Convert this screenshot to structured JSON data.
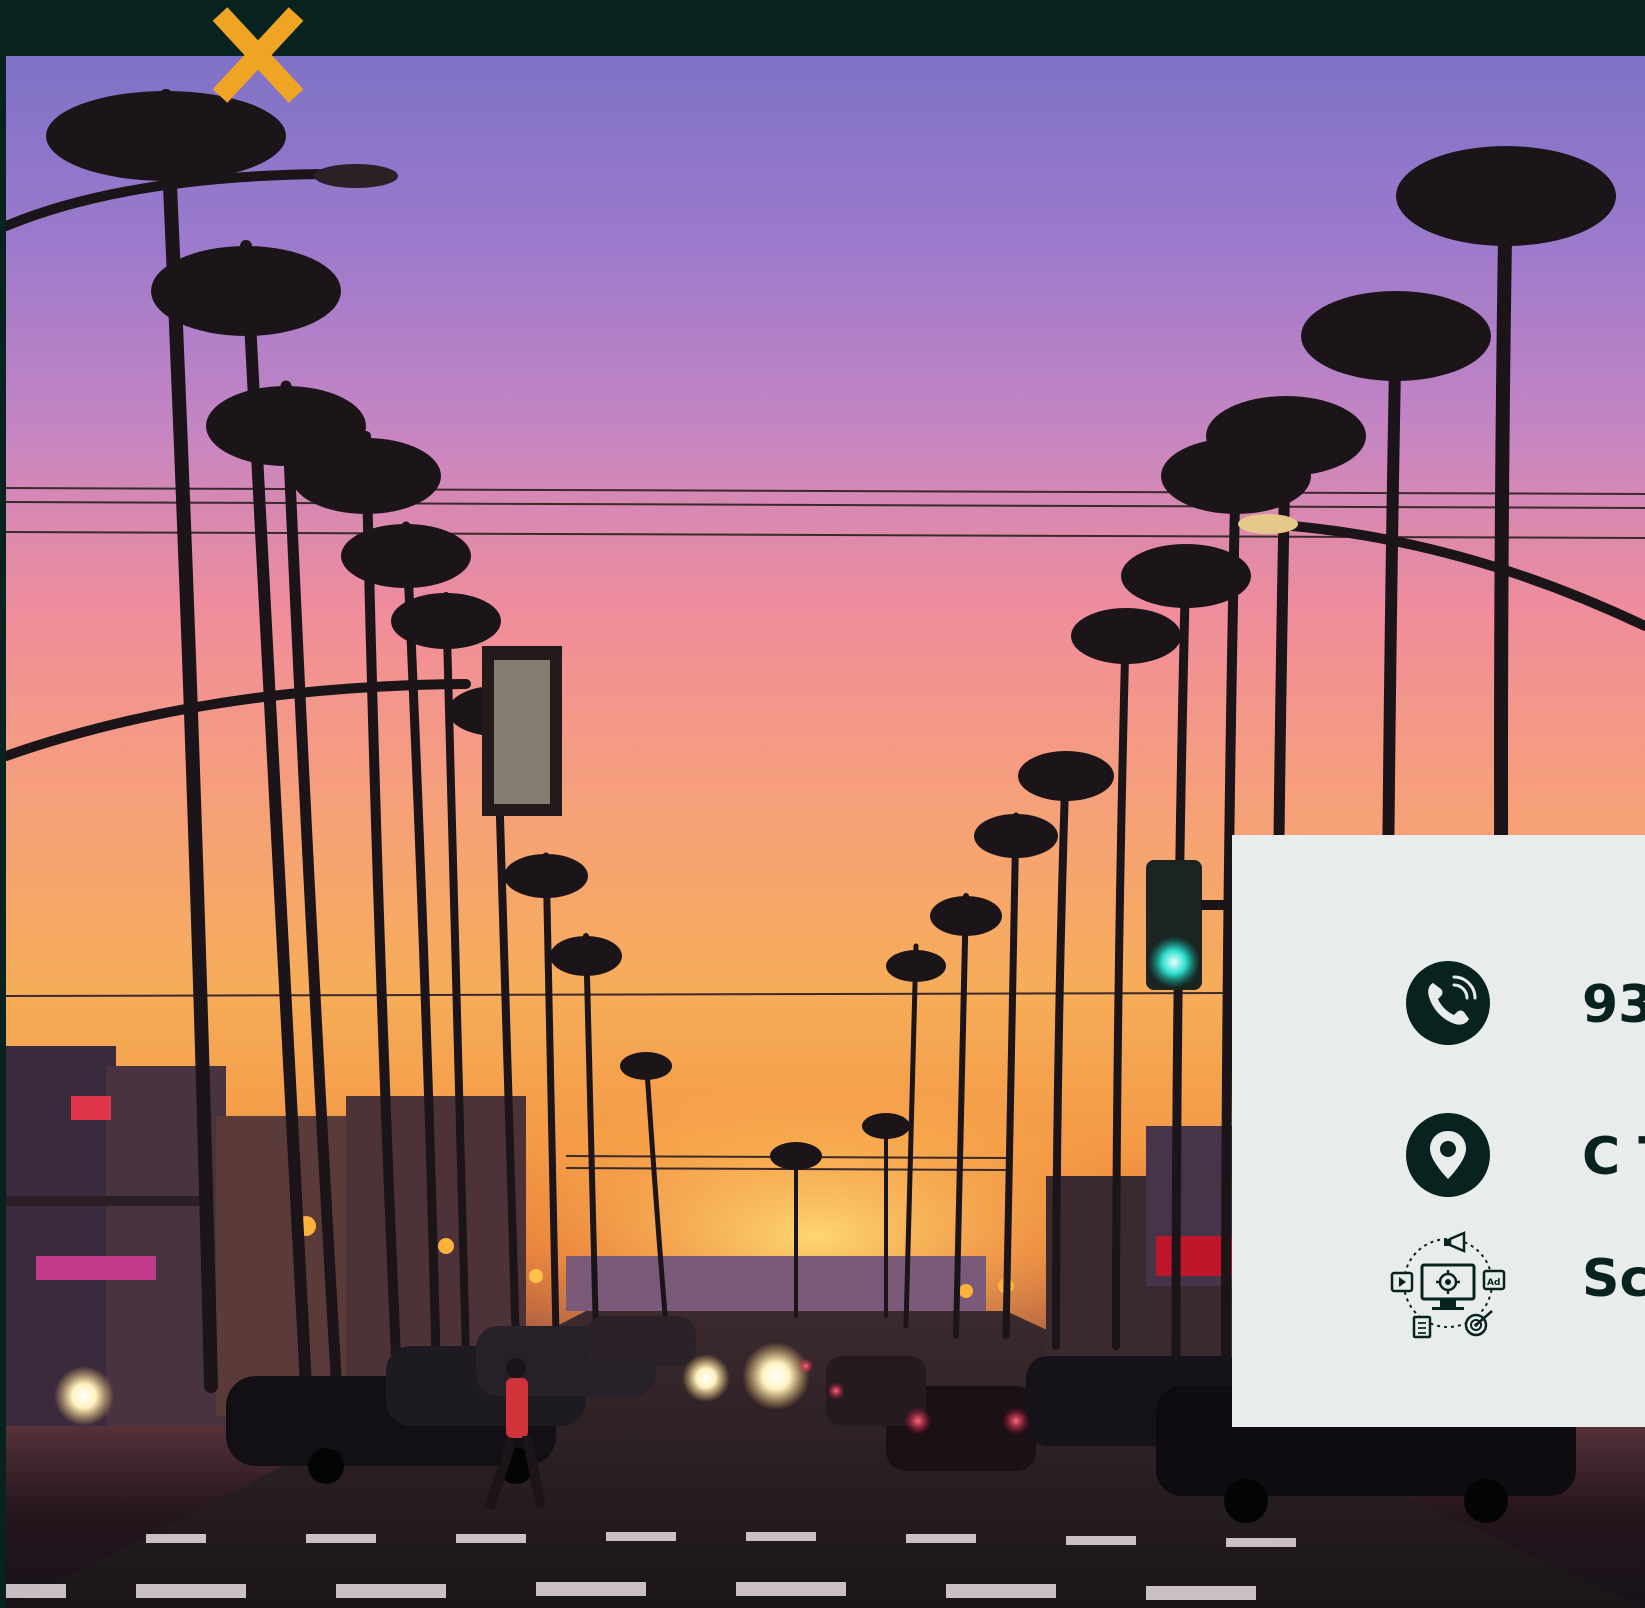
{
  "header": {
    "close_icon": "close-x-icon",
    "close_color": "#f0a424",
    "background": "#08231f"
  },
  "hero": {
    "scene": "boulevard-sunset-photo"
  },
  "contact_card": {
    "background": "#e8edec",
    "items": [
      {
        "icon": "phone-icon",
        "text": "93"
      },
      {
        "icon": "location-pin-icon",
        "text": "C T"
      },
      {
        "icon": "digital-marketing-icon",
        "text": "Sc"
      }
    ]
  }
}
